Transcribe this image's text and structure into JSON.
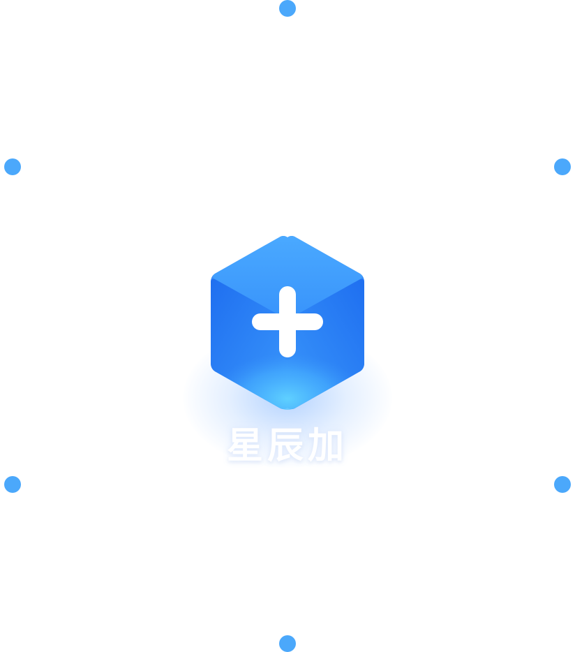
{
  "brand": {
    "name": "星辰加"
  },
  "colors": {
    "node": "#4ba8fb",
    "cube_top": "#47a6ff",
    "cube_left": "#2c7df0",
    "cube_right": "#2b7ef1",
    "cube_bottom_glow": "#5cc6ff",
    "plus": "#ffffff"
  },
  "icons": {
    "logo": "plus-cube-icon",
    "node": "dot-icon"
  }
}
